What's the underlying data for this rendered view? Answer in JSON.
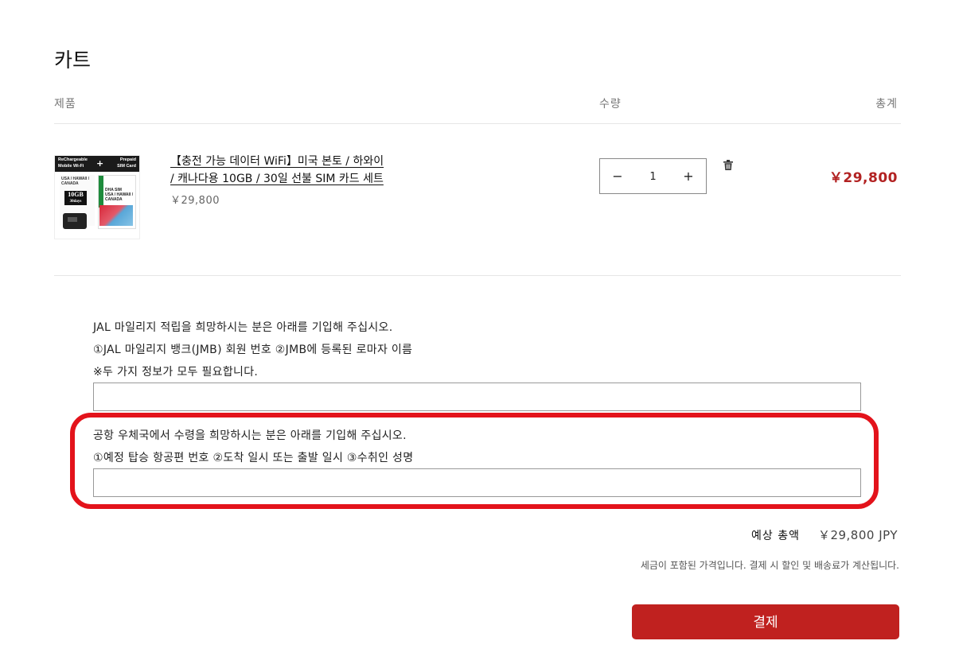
{
  "page": {
    "title": "카트"
  },
  "table": {
    "headers": {
      "product": "제품",
      "quantity": "수량",
      "total": "총계"
    }
  },
  "item": {
    "image_text": {
      "left": "ReChargeable\nMobile Wi-Fi",
      "right": "Prepaid\nSIM Card",
      "plus": "+",
      "region": "USA / HAWAII /\nCANADA",
      "capacity": "10GB",
      "days": "30days",
      "sim_title": "DHA SIM\nUSA / HAWAII /\nCANADA"
    },
    "name_line1": "【충전 가능 데이터 WiFi】미국 본토 / 하와이",
    "name_line2": "/ 캐나다용 10GB / 30일 선불 SIM 카드 세트",
    "unit_price": "￥29,800",
    "quantity": "1",
    "minus_symbol": "−",
    "plus_symbol": "+",
    "line_total": "￥29,800"
  },
  "notes": {
    "jal": {
      "line1": "JAL 마일리지 적립을 희망하시는 분은 아래를 기입해 주십시오.",
      "line2": "①JAL 마일리지 뱅크(JMB) 회원 번호 ②JMB에 등록된 로마자 이름",
      "line3": "※두 가지 정보가 모두 필요합니다.",
      "value": ""
    },
    "airport": {
      "line1": "공항 우체국에서 수령을 희망하시는 분은 아래를 기입해 주십시오.",
      "line2": "①예정 탑승 항공편 번호 ②도착 일시 또는 출발 일시 ③수취인 성명",
      "value": ""
    }
  },
  "summary": {
    "estimate_label": "예상 총액",
    "estimate_value": "￥29,800 JPY",
    "tax_note": "세금이 포함된 가격입니다. 결제 시 할인 및 배송료가 계산됩니다.",
    "checkout_label": "결제"
  },
  "colors": {
    "accent": "#c0211f",
    "price": "#b22222",
    "highlight": "#e3131b"
  },
  "icons": {
    "delete": "trash-icon"
  }
}
